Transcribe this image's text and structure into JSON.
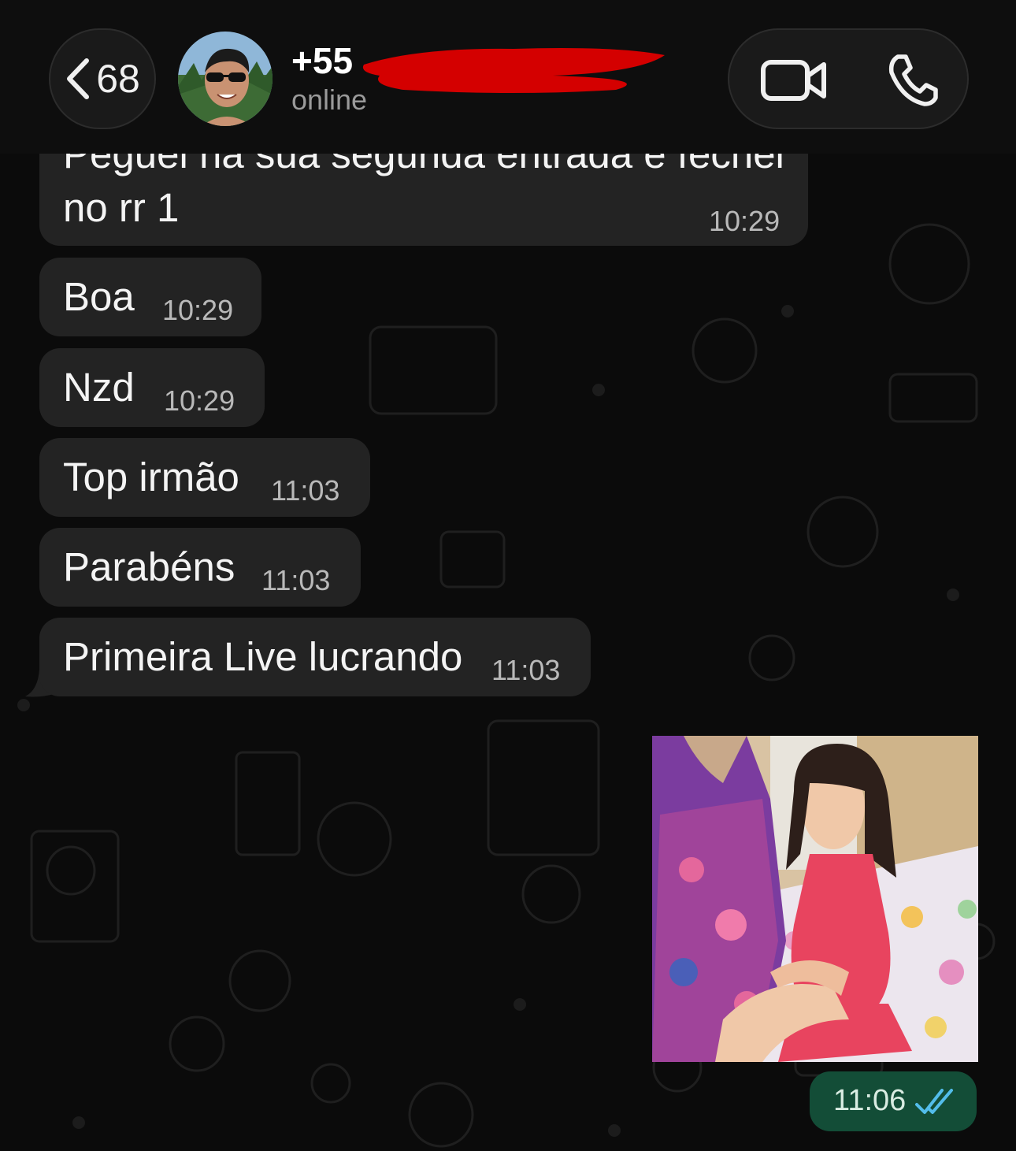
{
  "header": {
    "back_count": "68",
    "contact_name": "+55",
    "status": "online"
  },
  "icons": {
    "back": "chevron-left-icon",
    "video": "video-camera-icon",
    "phone": "phone-icon",
    "read_receipt": "double-check-icon"
  },
  "colors": {
    "incoming_bubble": "#232323",
    "outgoing_bubble": "#134d37",
    "read_ticks": "#53bdeb",
    "redaction": "#d40000"
  },
  "messages": [
    {
      "text_line1": "Peguei na sua segunda entrada e fechei",
      "text_line2": "no rr 1",
      "time": "10:29",
      "direction": "in"
    },
    {
      "text": "Boa",
      "time": "10:29",
      "direction": "in"
    },
    {
      "text": "Nzd",
      "time": "10:29",
      "direction": "in"
    },
    {
      "text": "Top irmão",
      "time": "11:03",
      "direction": "in"
    },
    {
      "text": "Parabéns",
      "time": "11:03",
      "direction": "in"
    },
    {
      "text": "Primeira Live lucrando",
      "time": "11:03",
      "direction": "in"
    },
    {
      "type": "image",
      "time": "11:06",
      "direction": "out",
      "status": "read"
    }
  ]
}
